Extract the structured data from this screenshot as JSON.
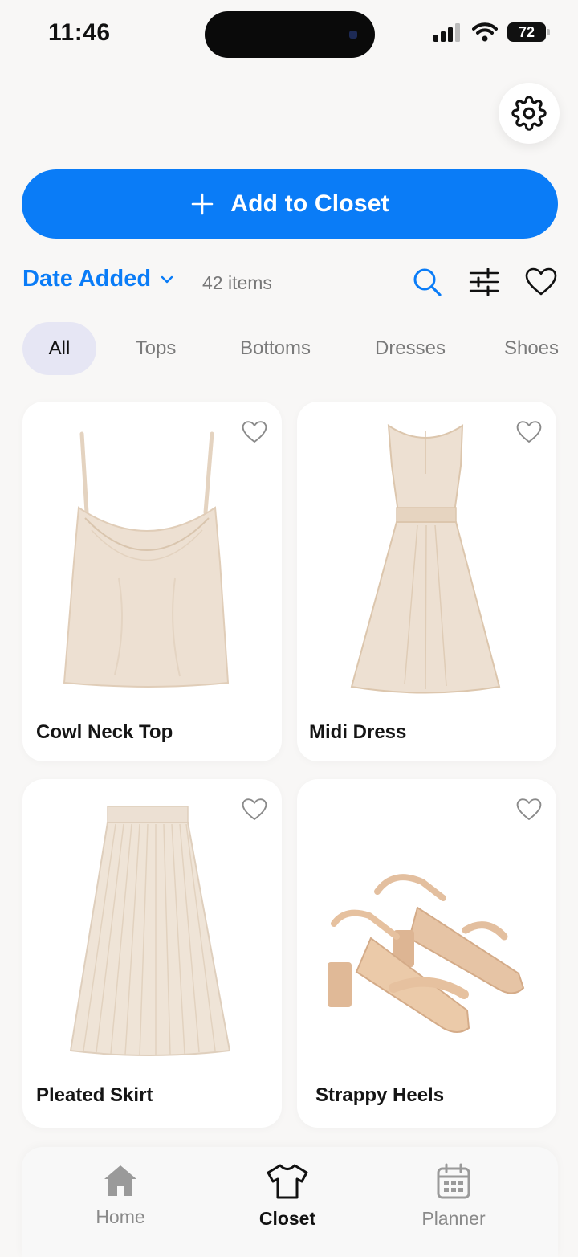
{
  "status_bar": {
    "time": "11:46",
    "battery": "72"
  },
  "header": {
    "add_button_label": "Add to Closet"
  },
  "sort": {
    "label": "Date Added",
    "count": "42 items"
  },
  "filters": [
    "All",
    "Tops",
    "Bottoms",
    "Dresses",
    "Shoes"
  ],
  "items": [
    {
      "name": "Cowl Neck Top"
    },
    {
      "name": "Midi Dress"
    },
    {
      "name": "Pleated Skirt"
    },
    {
      "name": "Strappy Heels"
    }
  ],
  "nav": [
    {
      "label": "Home",
      "icon": "home-icon"
    },
    {
      "label": "Closet",
      "icon": "tshirt-icon"
    },
    {
      "label": "Planner",
      "icon": "calendar-icon"
    }
  ],
  "colors": {
    "accent": "#0a7cf7",
    "chip_active_bg": "#e6e6f4",
    "background": "#f8f7f6",
    "garment": "#ede0d2",
    "shoe": "#e3bf9f"
  }
}
